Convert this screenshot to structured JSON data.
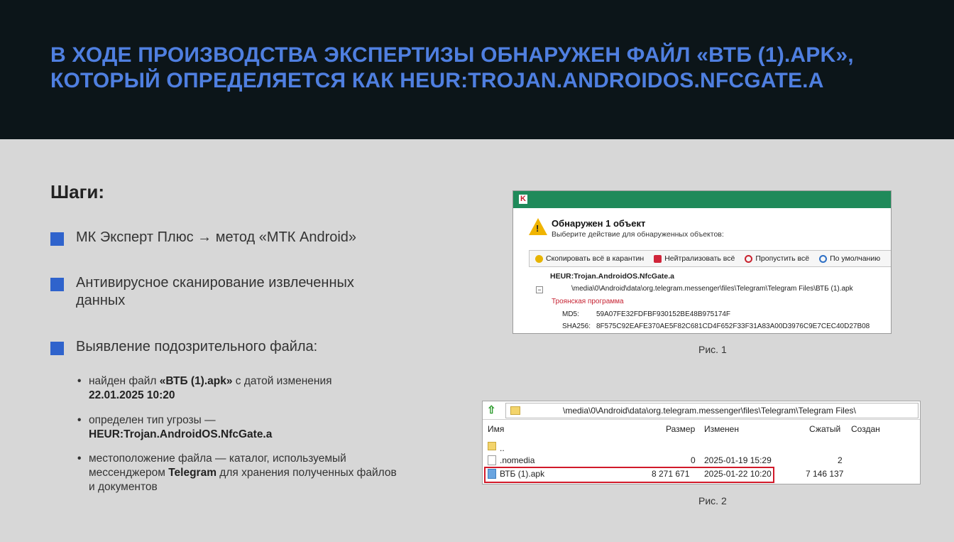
{
  "header": {
    "title_line1": "В ХОДЕ ПРОИЗВОДСТВА ЭКСПЕРТИЗЫ ОБНАРУЖЕН ФАЙЛ «ВТБ (1).APK»,",
    "title_line2": "КОТОРЫЙ ОПРЕДЕЛЯЕТСЯ КАК HEUR:TROJAN.ANDROIDOS.NFCGATE.A"
  },
  "steps": {
    "title": "Шаги:",
    "items": [
      "МК Эксперт Плюс → метод «МТК Android»",
      "Антивирусное сканирование извлеченных данных",
      "Выявление подозрительного файла:"
    ],
    "sub": {
      "s1_pre": "найден файл ",
      "s1_bold": "«ВТБ (1).apk»",
      "s1_post": " с датой изменения",
      "s1_date": "22.01.2025 10:20",
      "s2_pre": "определен тип угрозы —",
      "s2_bold": "HEUR:Trojan.AndroidOS.NfcGate.a",
      "s3_pre": "местоположение файла — каталог, используемый мессенджером ",
      "s3_bold": "Telegram",
      "s3_post": " для хранения полученных файлов и документов"
    }
  },
  "fig1": {
    "caption": "Рис. 1",
    "heading": "Обнаружен 1  объект",
    "subheading": "Выберите действие для обнаруженных объектов:",
    "tools": [
      "Скопировать всё в карантин",
      "Нейтрализовать всё",
      "Пропустить всё",
      "По умолчанию"
    ],
    "threat": "HEUR:Trojan.AndroidOS.NfcGate.a",
    "path": "\\media\\0\\Android\\data\\org.telegram.messenger\\files\\Telegram\\Telegram Files\\ВТБ (1).apk",
    "type": "Троянская программа",
    "md5_label": "MD5:",
    "md5": "59A07FE32FDFBF930152BE48B975174F",
    "sha_label": "SHA256:",
    "sha": "8F575C92EAFE370AE5F82C681CD4F652F33F31A83A00D3976C9E7CEC40D27B08"
  },
  "fig2": {
    "caption": "Рис. 2",
    "path": "\\media\\0\\Android\\data\\org.telegram.messenger\\files\\Telegram\\Telegram Files\\",
    "columns": {
      "name": "Имя",
      "size": "Размер",
      "modified": "Изменен",
      "packed": "Сжатый",
      "created": "Создан"
    },
    "rows": [
      {
        "name": "..",
        "size": "",
        "modified": "",
        "packed": ""
      },
      {
        "name": ".nomedia",
        "size": "0",
        "modified": "2025-01-19 15:29",
        "packed": "2"
      },
      {
        "name": "ВТБ (1).apk",
        "size": "8 271 671",
        "modified": "2025-01-22 10:20",
        "packed": "7 146 137"
      }
    ]
  },
  "colors": {
    "header_bg": "#0c1519",
    "title": "#4f7fe0",
    "bullet": "#2f63cc",
    "highlight": "#d11a2a"
  }
}
